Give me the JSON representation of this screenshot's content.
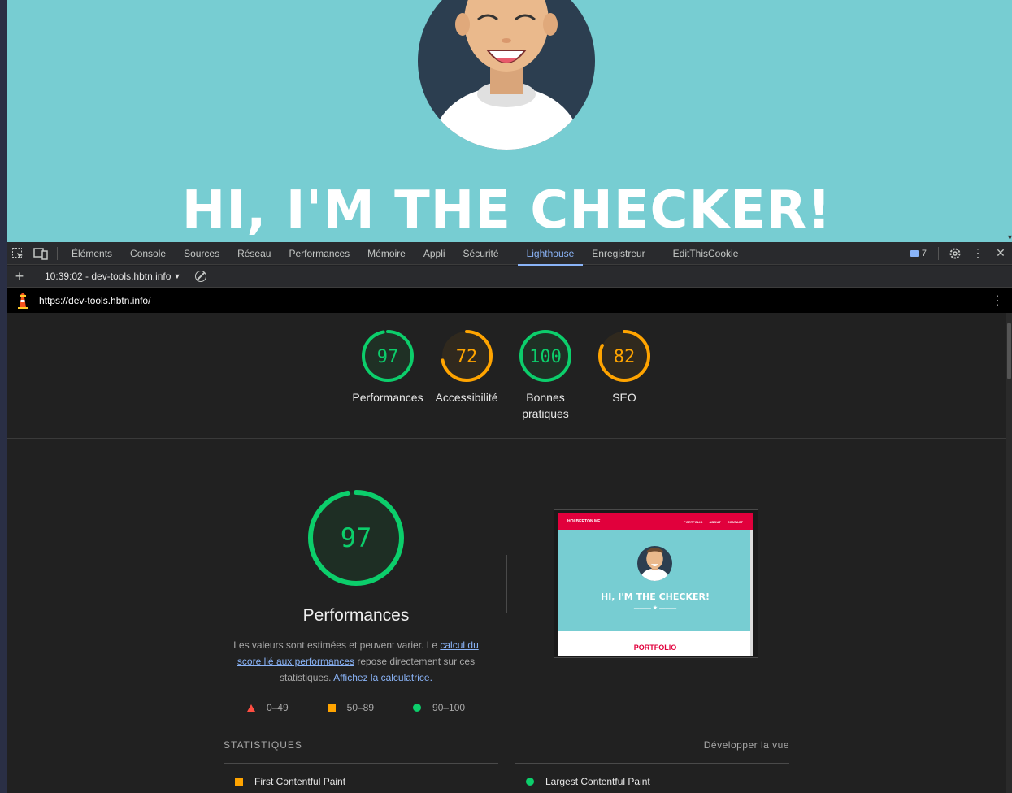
{
  "page_preview": {
    "hero_title": "HI, I'M THE CHECKER!"
  },
  "devtools": {
    "tabs": [
      "Éléments",
      "Console",
      "Sources",
      "Réseau",
      "Performances",
      "Mémoire",
      "Appli",
      "Sécurité",
      "Lighthouse",
      "Enregistreur",
      "EditThisCookie"
    ],
    "active_tab": "Lighthouse",
    "issues_count": "7"
  },
  "report_toolbar": {
    "report_selector": "10:39:02 - dev-tools.hbtn.info"
  },
  "url_bar": {
    "url": "https://dev-tools.hbtn.info/"
  },
  "scores": [
    {
      "label": "Performances",
      "value": "97",
      "score": 97,
      "color": "#0cce6b"
    },
    {
      "label": "Accessibilité",
      "value": "72",
      "score": 72,
      "color": "#ffa400"
    },
    {
      "label": "Bonnes pratiques",
      "value": "100",
      "score": 100,
      "color": "#0cce6b"
    },
    {
      "label": "SEO",
      "value": "82",
      "score": 82,
      "color": "#ffa400"
    }
  ],
  "performance": {
    "score": "97",
    "score_value": 97,
    "title": "Performances",
    "desc_1": "Les valeurs sont estimées et peuvent varier. Le ",
    "desc_link_1": "calcul du score lié aux performances",
    "desc_2": " repose directement sur ces statistiques. ",
    "desc_link_2": "Affichez la calculatrice.",
    "legend": [
      "0–49",
      "50–89",
      "90–100"
    ]
  },
  "screenshot": {
    "nav_brand": "HOLBERTON ME",
    "nav_links": [
      "PORTFOLIO",
      "ABOUT",
      "CONTACT"
    ],
    "title": "HI, I'M THE CHECKER!",
    "star": "——— ★ ———",
    "section": "PORTFOLIO"
  },
  "stats": {
    "heading": "STATISTIQUES",
    "expand": "Développer la vue",
    "metric_left": "First Contentful Paint",
    "metric_right": "Largest Contentful Paint"
  }
}
